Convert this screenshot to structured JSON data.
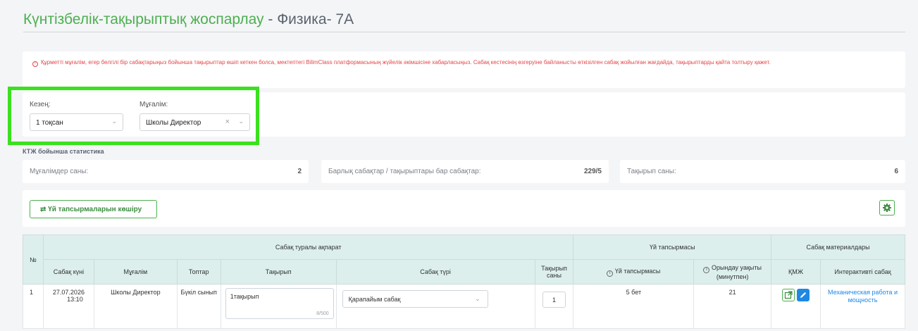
{
  "page": {
    "title_main": "Күнтізбелік-тақырыптық жоспарлау",
    "title_sub": " - Физика- 7А"
  },
  "alert": {
    "icon": "info-circle-icon",
    "text": "Құрметті мұғалім, егер белгілі бір сабақтарыңыз бойынша тақырыптар өшіп кеткен болса, мектептегі BilimClass платформасының жүйелік әкімшісіне хабарласыңыз. Сабақ кестесінің өзгеруіне байланысты өткізілген сабақ жойылған жағдайда, тақырыптарды қайта толтыру қажет."
  },
  "filters": {
    "period_label": "Кезең:",
    "period_value": "1 тоқсан",
    "teacher_label": "Мұғалім:",
    "teacher_value": "Школы Директор"
  },
  "stats": {
    "title": "КТЖ бойынша статистика",
    "teachers_label": "Мұғалімдер саны:",
    "teachers_value": "2",
    "lessons_label": "Барлық сабақтар / тақырыптары бар сабақтар:",
    "lessons_value": "229/5",
    "topics_label": "Тақырып саны:",
    "topics_value": "6"
  },
  "toolbar": {
    "copy_label": "Үй тапсырмаларын көшіру"
  },
  "table": {
    "num_header": "№",
    "group_lesson": "Сабақ туралы ақпарат",
    "group_homework": "Үй тапсырмасы",
    "group_materials": "Сабақ материалдары",
    "columns": [
      "Сабақ күні",
      "Мұғалім",
      "Топтар",
      "Тақырып",
      "Сабақ түрі",
      "Тақырып саны",
      "Үй тапсырмасы",
      "Орындау уақыты (минутпен)",
      "ҚМЖ",
      "Интерактивті сабақ"
    ],
    "rows": [
      {
        "num": "1",
        "date": "27.07.2026",
        "time": "13:10",
        "teacher": "Школы Директор",
        "groups": "Бүкіл сынып",
        "topic": "1тақырып",
        "topic_count": "8/500",
        "lesson_type": "Қарапайым сабақ",
        "topics_num": "1",
        "homework": "5 бет",
        "duration": "21",
        "interactive": "Механическая работа и мощность"
      }
    ]
  },
  "colors": {
    "accent": "#4caf50",
    "alert": "#e2474b",
    "link": "#1e88e5",
    "highlight": "#3be01e"
  }
}
